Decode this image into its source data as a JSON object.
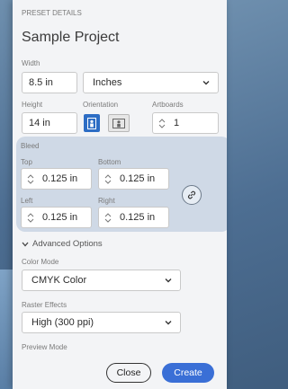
{
  "header": {
    "section_label": "PRESET DETAILS",
    "title": "Sample Project"
  },
  "size": {
    "width_label": "Width",
    "width_value": "8.5 in",
    "units_value": "Inches",
    "height_label": "Height",
    "height_value": "14 in",
    "orientation_label": "Orientation",
    "artboards_label": "Artboards",
    "artboards_value": "1"
  },
  "bleed": {
    "label": "Bleed",
    "top_label": "Top",
    "top_value": "0.125 in",
    "bottom_label": "Bottom",
    "bottom_value": "0.125 in",
    "left_label": "Left",
    "left_value": "0.125 in",
    "right_label": "Right",
    "right_value": "0.125 in"
  },
  "advanced": {
    "toggle_label": "Advanced Options",
    "color_mode_label": "Color Mode",
    "color_mode_value": "CMYK Color",
    "raster_label": "Raster Effects",
    "raster_value": "High (300 ppi)",
    "preview_label": "Preview Mode"
  },
  "footer": {
    "close_label": "Close",
    "create_label": "Create"
  },
  "colors": {
    "accent": "#2f6fd1",
    "bleed_bg": "#cfd9e6",
    "portrait_active": "#2d6dc4",
    "create_bg": "#3a6fd6"
  }
}
